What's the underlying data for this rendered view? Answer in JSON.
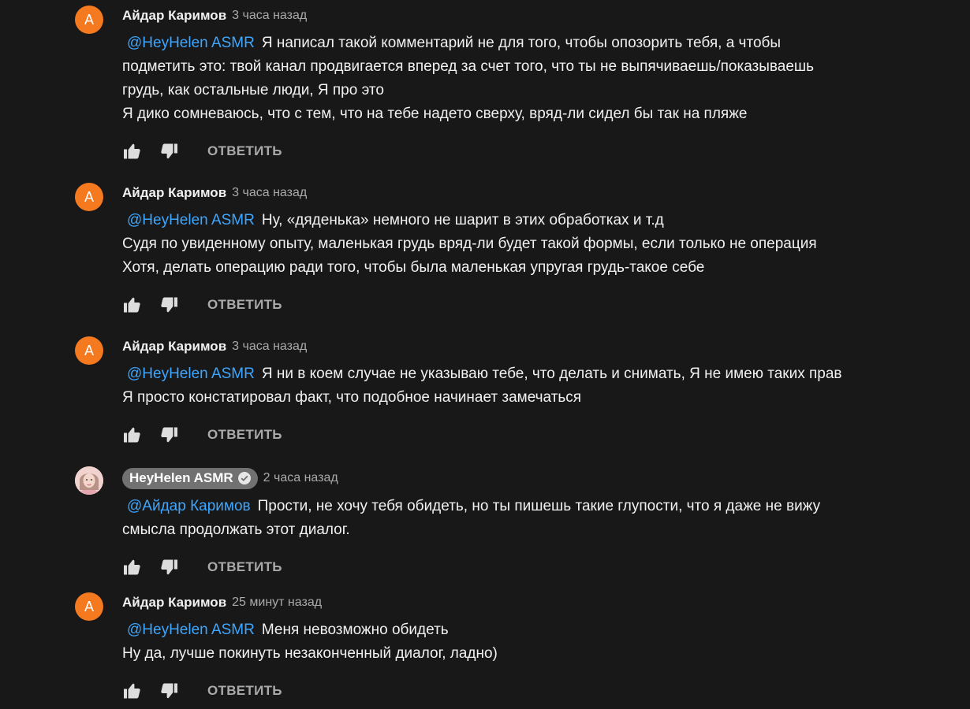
{
  "comments": [
    {
      "avatar_letter": "А",
      "author": "Айдар Каримов",
      "time": "3 часа назад",
      "mention": "@HeyHelen ASMR",
      "first_line": "Я написал такой комментарий не для того, чтобы опозорить тебя, а чтобы",
      "lines": [
        "подметить это: твой канал продвигается вперед за счет того, что ты не выпячиваешь/показываешь",
        "грудь, как остальные люди, Я про это",
        "Я дико сомневаюсь, что с тем, что на тебе надето сверху, вряд-ли сидел бы так на пляже"
      ],
      "reply_label": "ОТВЕТИТЬ"
    },
    {
      "avatar_letter": "А",
      "author": "Айдар Каримов",
      "time": "3 часа назад",
      "mention": "@HeyHelen ASMR",
      "first_line": "Ну, «дяденька» немного не шарит в этих обработках и т.д",
      "lines": [
        "Судя по увиденному опыту, маленькая грудь вряд-ли будет такой формы, если только не операция",
        "Хотя, делать операцию ради того, чтобы была маленькая упругая грудь-такое себе"
      ],
      "reply_label": "ОТВЕТИТЬ"
    },
    {
      "avatar_letter": "А",
      "author": "Айдар Каримов",
      "time": "3 часа назад",
      "mention": "@HeyHelen ASMR",
      "first_line": "Я ни в коем случае не указываю тебе, что делать и снимать,  Я не имею таких прав",
      "lines": [
        "Я просто констатировал факт, что подобное начинает замечаться"
      ],
      "reply_label": "ОТВЕТИТЬ"
    },
    {
      "author": "HeyHelen ASMR",
      "time": "2 часа назад",
      "mention": "@Айдар Каримов",
      "first_line": "Прости, не хочу тебя обидеть, но ты пишешь такие глупости, что я даже не вижу",
      "lines": [
        "смысла продолжать этот диалог."
      ],
      "reply_label": "ОТВЕТИТЬ"
    },
    {
      "avatar_letter": "А",
      "author": "Айдар Каримов",
      "time": "25 минут назад",
      "mention": "@HeyHelen ASMR",
      "first_line": "Меня невозможно обидеть",
      "lines": [
        "Ну да, лучше покинуть незаконченный диалог, ладно)"
      ],
      "reply_label": "ОТВЕТИТЬ"
    }
  ],
  "colors": {
    "background": "#181818",
    "text": "#f1f1f1",
    "secondary_text": "#aaaaaa",
    "mention": "#3ea6ff",
    "avatar_orange": "#f4791f",
    "owner_badge": "#717171"
  },
  "icons": {
    "like": "thumb-up-icon",
    "dislike": "thumb-down-icon",
    "verified": "verified-check-icon"
  }
}
